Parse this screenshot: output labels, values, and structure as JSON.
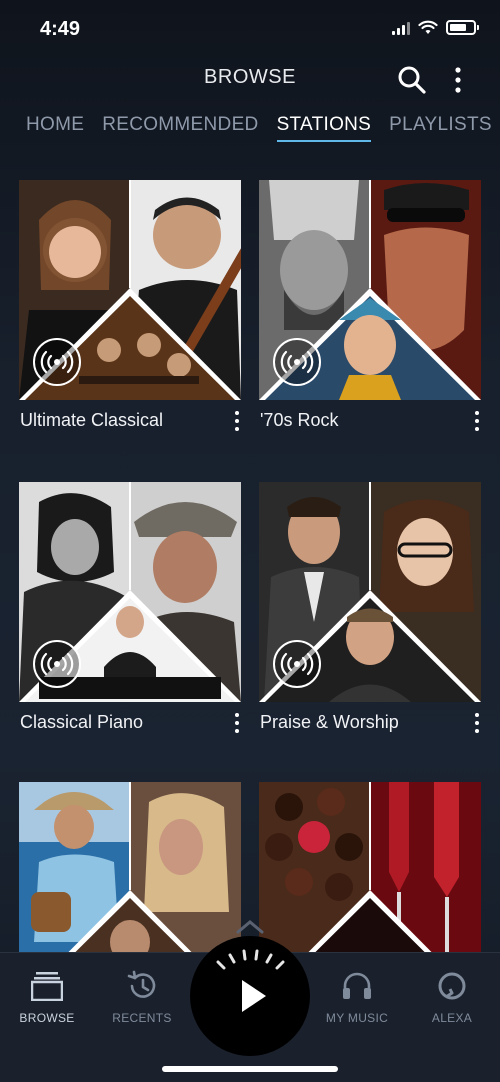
{
  "status_bar": {
    "time": "4:49"
  },
  "header": {
    "title": "BROWSE"
  },
  "tabs": [
    {
      "label": "HOME",
      "active": false
    },
    {
      "label": "RECOMMENDED",
      "active": false
    },
    {
      "label": "STATIONS",
      "active": true
    },
    {
      "label": "PLAYLISTS",
      "active": false
    }
  ],
  "stations": [
    {
      "title": "Ultimate Classical"
    },
    {
      "title": "'70s Rock"
    },
    {
      "title": "Classical Piano"
    },
    {
      "title": "Praise & Worship"
    },
    {
      "title": ""
    },
    {
      "title": ""
    }
  ],
  "bottom_nav": {
    "browse": "BROWSE",
    "recents": "RECENTS",
    "my_music": "MY MUSIC",
    "alexa": "ALEXA"
  },
  "colors": {
    "accent": "#5fb8e8",
    "tab_inactive": "#8e99aa",
    "nav_bg": "#1a212c"
  }
}
